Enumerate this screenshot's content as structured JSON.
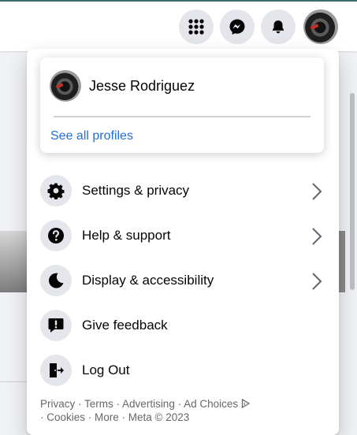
{
  "topbar": {
    "buttons": [
      "menu-grid-icon",
      "messenger-icon",
      "bell-icon",
      "account-avatar"
    ]
  },
  "profile": {
    "name": "Jesse Rodriguez",
    "see_all_label": "See all profiles"
  },
  "menu": {
    "items": [
      {
        "label": "Settings & privacy",
        "icon": "gear-icon",
        "has_chevron": true
      },
      {
        "label": "Help & support",
        "icon": "question-icon",
        "has_chevron": true
      },
      {
        "label": "Display & accessibility",
        "icon": "moon-icon",
        "has_chevron": true
      },
      {
        "label": "Give feedback",
        "icon": "feedback-icon",
        "has_chevron": false
      },
      {
        "label": "Log Out",
        "icon": "logout-icon",
        "has_chevron": false
      }
    ]
  },
  "footer": {
    "links": [
      "Privacy",
      "Terms",
      "Advertising",
      "Ad Choices",
      "Cookies",
      "More"
    ],
    "separator": " · ",
    "copyright": "Meta © 2023"
  },
  "colors": {
    "link_blue": "#216fdb",
    "icon_bg": "#e4e6eb",
    "text_primary": "#050505",
    "text_secondary": "#65676b"
  }
}
